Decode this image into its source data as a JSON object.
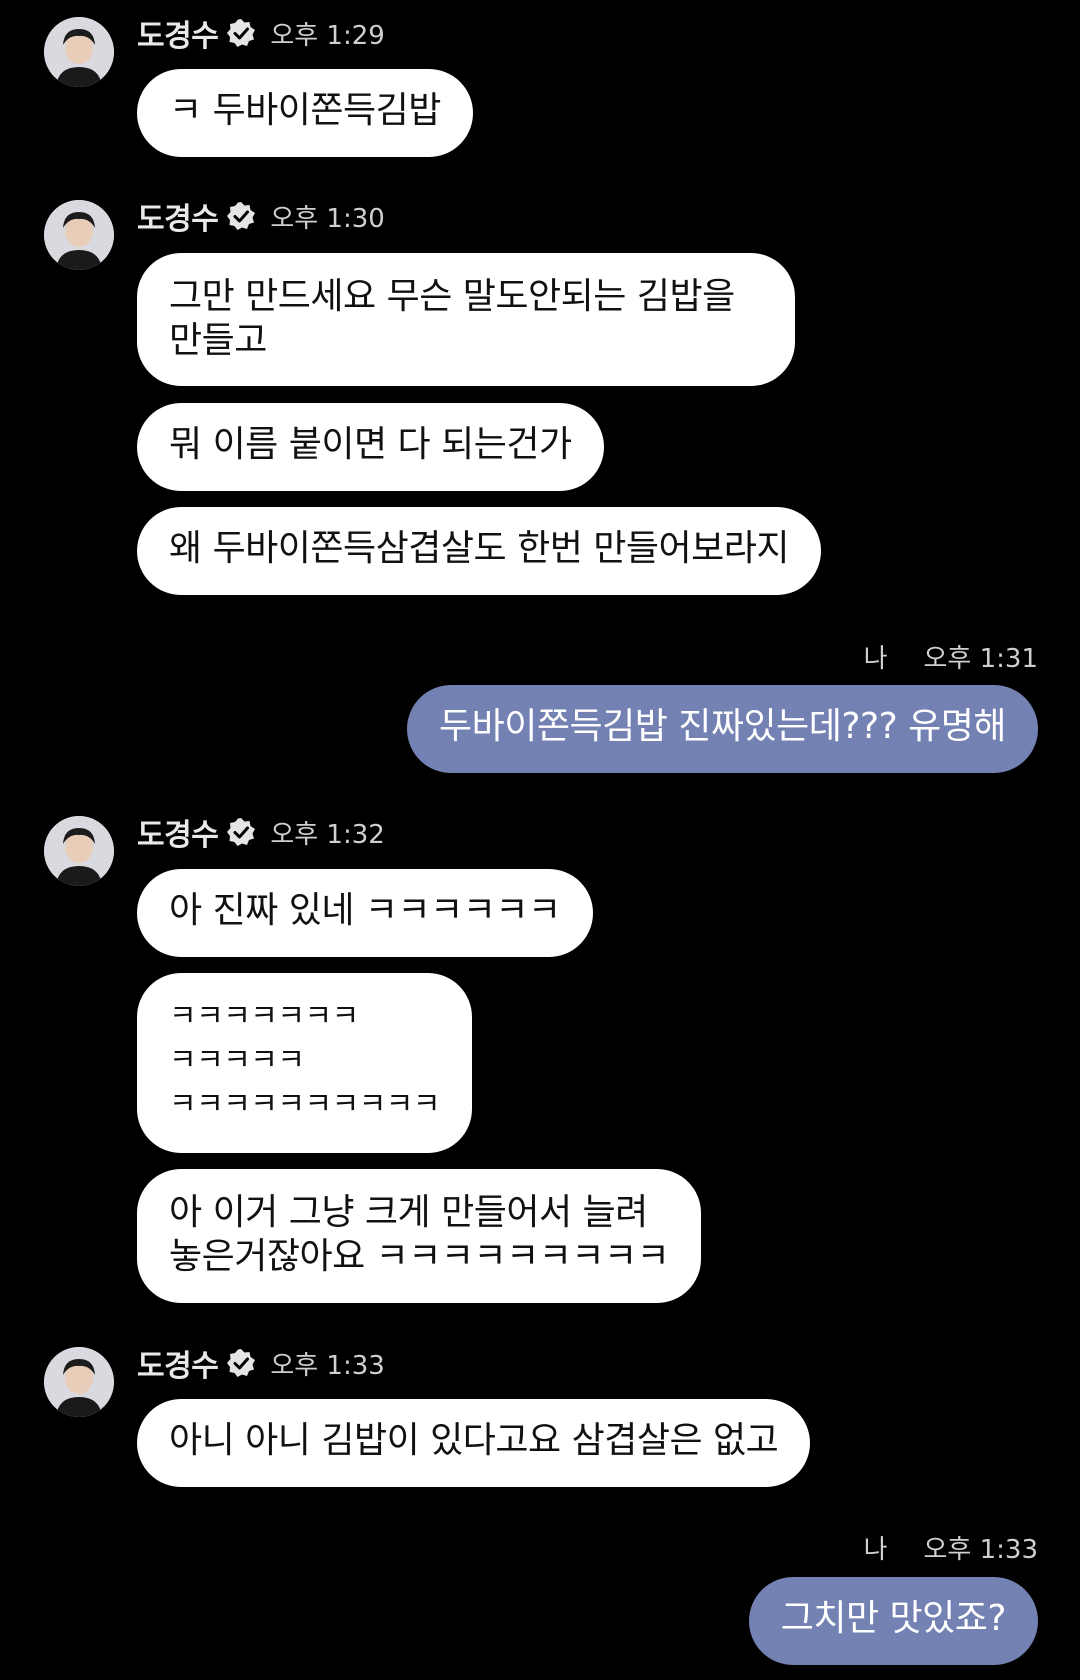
{
  "sender": {
    "name": "도경수",
    "avatar_icon": "profile-photo",
    "verified_icon": "verified-badge-icon"
  },
  "me": {
    "label": "나"
  },
  "groups": [
    {
      "time": "오후 1:29",
      "messages": [
        "ㅋ 두바이쫀득김밥"
      ]
    },
    {
      "time": "오후 1:30",
      "messages": [
        "그만 만드세요 무슨 말도안되는 김밥을\n만들고",
        "뭐 이름 붙이면 다 되는건가",
        "왜 두바이쫀득삼겹살도 한번 만들어보라지"
      ]
    },
    {
      "time": "오후 1:31",
      "mine": true,
      "messages": [
        "두바이쫀득김밥 진짜있는데??? 유명해"
      ]
    },
    {
      "time": "오후 1:32",
      "messages": [
        "아 진짜 있네 ㅋㅋㅋㅋㅋㅋ",
        "ㅋㅋㅋㅋㅋㅋㅋ\nㅋㅋㅋㅋㅋ\nㅋㅋㅋㅋㅋㅋㅋㅋㅋㅋ",
        "아 이거 그냥 크게 만들어서 늘려\n놓은거잖아요 ㅋㅋㅋㅋㅋㅋㅋㅋㅋ"
      ]
    },
    {
      "time": "오후 1:33",
      "messages": [
        "아니 아니 김밥이 있다고요 삼겹살은 없고"
      ]
    },
    {
      "time": "오후 1:33",
      "mine": true,
      "messages": [
        "그치만 맛있죠?"
      ]
    }
  ],
  "colors": {
    "background": "#000000",
    "their_bubble": "#ffffff",
    "my_bubble": "#7482b3"
  }
}
